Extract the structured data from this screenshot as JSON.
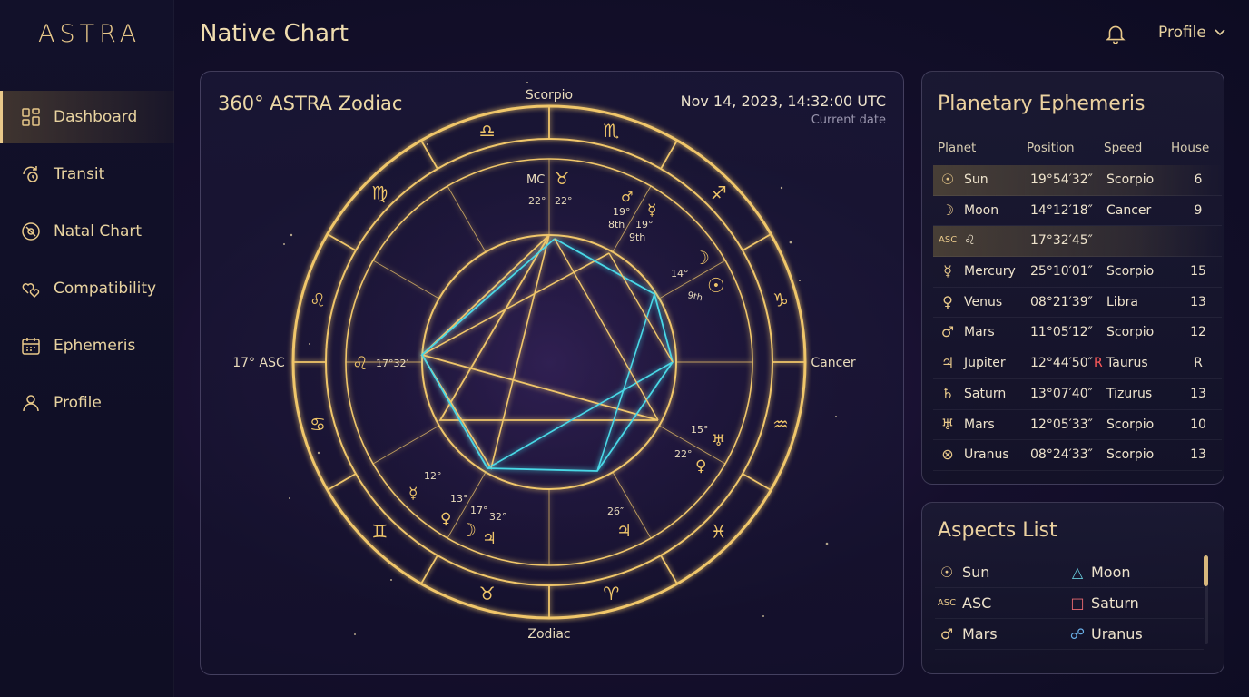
{
  "app": {
    "logo": "ASTRA"
  },
  "header": {
    "title": "Native Chart",
    "profile_label": "Profile"
  },
  "sidebar": {
    "items": [
      {
        "label": "Dashboard",
        "icon": "grid-icon",
        "active": true
      },
      {
        "label": "Transit",
        "icon": "transit-icon"
      },
      {
        "label": "Natal Chart",
        "icon": "compass-icon"
      },
      {
        "label": "Compatibility",
        "icon": "hearts-icon"
      },
      {
        "label": "Ephemeris",
        "icon": "calendar-icon"
      },
      {
        "label": "Profile",
        "icon": "user-icon"
      }
    ]
  },
  "chart": {
    "title": "360° ASTRA Zodiac",
    "date": "Nov 14, 2023, 14:32:00 UTC",
    "date_caption": "Current date",
    "labels": {
      "top": "Scorpio",
      "bottom": "Zodiac",
      "left": "17° ASC",
      "right": "Cancer"
    },
    "zodiac_glyphs": [
      "♎",
      "♍",
      "♌",
      "♋",
      "♊",
      "♉",
      "♈",
      "♓",
      "♒",
      "♑",
      "♐",
      "♏"
    ],
    "annotations": {
      "mc": "MC",
      "mc_taurus": "♉",
      "mc_deg1": "22°",
      "mc_deg2": "22°",
      "mars_top": "♂",
      "deg_19a": "19°",
      "deg_8th": "8th",
      "merc_top": "☿",
      "deg_19b": "19°",
      "deg_9th": "9th",
      "moon_r": "☽",
      "deg_14": "14°",
      "deg_9th2": "9th",
      "sun_r": "☉",
      "asc_leo": "♌",
      "asc_deg": "17°32′",
      "deg_15": "15°",
      "uranus_r": "♅",
      "deg_22": "22°",
      "venus_r": "♀",
      "deg_12": "12°",
      "merc_bl": "☿",
      "deg_13": "13°",
      "venus_bl": "♀",
      "deg_17": "17°",
      "moon_bl": "☽",
      "deg_32": "32°",
      "jup_bl": "♃",
      "deg_26": "26″",
      "jup_b": "♃"
    },
    "colors": {
      "gold": "#f0c66a",
      "cyan": "#48d8e6"
    }
  },
  "ephemeris": {
    "title": "Planetary Ephemeris",
    "columns": [
      "Planet",
      "Position",
      "Speed",
      "House"
    ],
    "rows": [
      {
        "glyph": "☉",
        "name": "Sun",
        "position": "19°54′32″",
        "retro": "",
        "speed": "Scorpio",
        "house": "6",
        "highlight": true
      },
      {
        "glyph": "☽",
        "name": "Moon",
        "position": "14°12′18″",
        "retro": "",
        "speed": "Cancer",
        "house": "9",
        "highlight": false
      },
      {
        "glyph": "ASC",
        "name": "♌",
        "position": "17°32′45″",
        "retro": "",
        "speed": "",
        "house": "",
        "highlight": true
      },
      {
        "glyph": "☿",
        "name": "Mercury",
        "position": "25°10′01″",
        "retro": "",
        "speed": "Scorpio",
        "house": "15",
        "highlight": false
      },
      {
        "glyph": "♀",
        "name": "Venus",
        "position": "08°21′39″",
        "retro": "",
        "speed": "Libra",
        "house": "13",
        "highlight": false
      },
      {
        "glyph": "♂",
        "name": "Mars",
        "position": "11°05′12″",
        "retro": "",
        "speed": "Scorpio",
        "house": "12",
        "highlight": false
      },
      {
        "glyph": "♃",
        "name": "Jupiter",
        "position": "12°44′50″",
        "retro": "R",
        "speed": "Taurus",
        "house": "R",
        "highlight": false
      },
      {
        "glyph": "♄",
        "name": "Saturn",
        "position": "13°07′40″",
        "retro": "",
        "speed": "Tizurus",
        "house": "13",
        "highlight": false
      },
      {
        "glyph": "♅",
        "name": "Mars",
        "position": "12°05′33″",
        "retro": "",
        "speed": "Scorpio",
        "house": "10",
        "highlight": false
      },
      {
        "glyph": "⊗",
        "name": "Uranus",
        "position": "08°24′33″",
        "retro": "",
        "speed": "Scorpio",
        "house": "13",
        "highlight": false
      }
    ]
  },
  "aspects": {
    "title": "Aspects List",
    "rows": [
      {
        "g1": "☉",
        "n1": "Sun",
        "g2": "△",
        "c2": "#66c9d8",
        "n2": "Moon"
      },
      {
        "g1": "ASC",
        "n1": "ASC",
        "g2": "□",
        "c2": "#e86a70",
        "n2": "Saturn"
      },
      {
        "g1": "♂",
        "n1": "Mars",
        "g2": "☍",
        "c2": "#6ab0e8",
        "n2": "Uranus"
      }
    ]
  }
}
